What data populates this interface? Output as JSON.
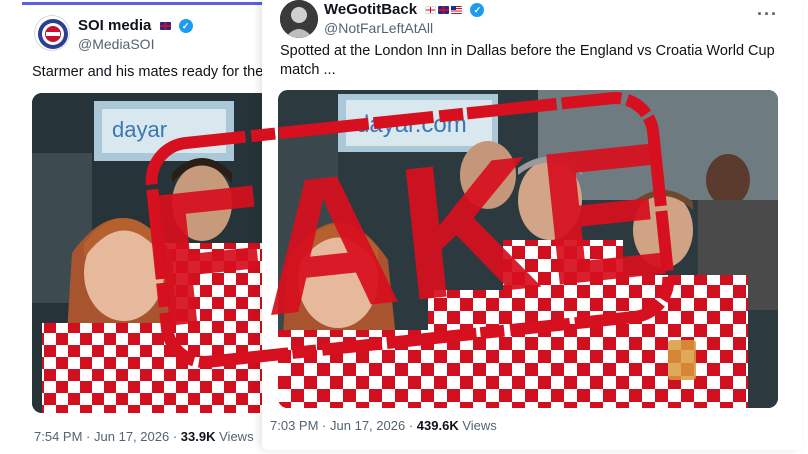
{
  "left_post": {
    "display_name": "SOI media",
    "handle": "@MediaSOI",
    "text": "Starmer and his mates ready for the ga",
    "photo_sign": "dayar",
    "time": "7:54 PM",
    "date": "Jun 17, 2026",
    "views_count": "33.9K",
    "views_label": "Views"
  },
  "right_post": {
    "display_name": "WeGotitBack",
    "handle": "@NotFarLeftAtAll",
    "text": "Spotted at the London Inn in Dallas before the England vs Croatia World Cup match ...",
    "photo_sign": "dayar.com",
    "time": "7:03 PM",
    "date": "Jun 17, 2026",
    "views_count": "439.6K",
    "views_label": "Views"
  },
  "overlay": {
    "stamp_text": "FAKE",
    "stamp_color": "#d7101f"
  },
  "colors": {
    "verified": "#1d9bf0",
    "croatia_red": "#d0101e",
    "muted_text": "#536471"
  },
  "separator": "·",
  "more_glyph": "···"
}
